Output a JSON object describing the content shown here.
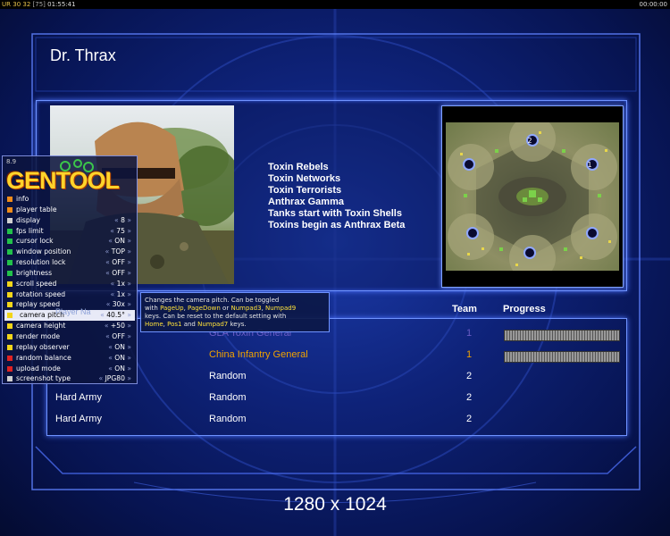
{
  "top_bar": {
    "ur_label": "UR",
    "stats_line": "30 32",
    "bracket_value": "[75]",
    "time_left": "01:55:41",
    "time_right": "00:00:00"
  },
  "map_title": "Dr. Thrax",
  "rules": [
    "Toxin Rebels",
    "Toxin Networks",
    "Toxin Terrorists",
    "Anthrax Gamma",
    "Tanks start with Toxin Shells",
    "Toxins begin as Anthrax Beta"
  ],
  "minimap": {
    "start_labels": [
      "2",
      "1"
    ]
  },
  "headers": {
    "team": "Team",
    "progress": "Progress"
  },
  "players": [
    {
      "name": "",
      "army": "GLA Toxin General",
      "team": "1",
      "progress": 1.0,
      "color": "#6b5cc4"
    },
    {
      "name": "",
      "army": "China Infantry General",
      "team": "1",
      "progress": 1.0,
      "color": "#f0a200"
    },
    {
      "name": "",
      "army": "Random",
      "team": "2",
      "progress": null,
      "color": "#ffffff"
    },
    {
      "name": "Hard Army",
      "army": "Random",
      "team": "2",
      "progress": null,
      "color": "#ffffff"
    },
    {
      "name": "Hard Army",
      "army": "Random",
      "team": "2",
      "progress": null,
      "color": "#ffffff"
    }
  ],
  "resolution": "1280 x 1024",
  "gentool": {
    "version": "8.9",
    "logo": "GENTOOL",
    "items": [
      {
        "label": "info",
        "value": "",
        "color": "#f08c1a",
        "selected": false
      },
      {
        "label": "player table",
        "value": "",
        "color": "#f08c1a",
        "selected": false
      },
      {
        "label": "display",
        "value": "8",
        "color": "#d0d0d0",
        "selected": false
      },
      {
        "label": "fps limit",
        "value": "75",
        "color": "#22c14a",
        "selected": false
      },
      {
        "label": "cursor lock",
        "value": "ON",
        "color": "#22c14a",
        "selected": false
      },
      {
        "label": "window position",
        "value": "TOP",
        "color": "#22c14a",
        "selected": false
      },
      {
        "label": "resolution lock",
        "value": "OFF",
        "color": "#22c14a",
        "selected": false
      },
      {
        "label": "brightness",
        "value": "OFF",
        "color": "#22c14a",
        "selected": false
      },
      {
        "label": "scroll speed",
        "value": "1x",
        "color": "#f2d51a",
        "selected": false
      },
      {
        "label": "rotation speed",
        "value": "1x",
        "color": "#f2d51a",
        "selected": false
      },
      {
        "label": "replay speed",
        "value": "30x",
        "color": "#f2d51a",
        "selected": false
      },
      {
        "label": "camera pitch",
        "value": "40.5°",
        "color": "#f2d51a",
        "selected": true
      },
      {
        "label": "camera height",
        "value": "+50",
        "color": "#f2d51a",
        "selected": false
      },
      {
        "label": "render mode",
        "value": "OFF",
        "color": "#f2d51a",
        "selected": false
      },
      {
        "label": "replay observer",
        "value": "ON",
        "color": "#f2d51a",
        "selected": false
      },
      {
        "label": "random balance",
        "value": "ON",
        "color": "#e02323",
        "selected": false
      },
      {
        "label": "upload mode",
        "value": "ON",
        "color": "#e02323",
        "selected": false
      },
      {
        "label": "screenshot type",
        "value": "JPG80",
        "color": "#d0d0d0",
        "selected": false
      }
    ],
    "tooltip": {
      "line1": "Changes the camera pitch. Can be toggled",
      "line2_pre": "with ",
      "key_pageup": "PageUp",
      "sep1": ", ",
      "key_pagedown": "PageDown",
      "sep2": " or ",
      "key_num3": "Numpad3",
      "sep3": ", ",
      "key_num9": "Numpad9",
      "line3": "keys. Can be reset to the default setting with",
      "key_home": "Home",
      "sep4": ", ",
      "key_pos1": "Pos1",
      "sep5": " and ",
      "key_num7": "Numpad7",
      "end": " keys."
    },
    "behind_header": "Player Na"
  }
}
